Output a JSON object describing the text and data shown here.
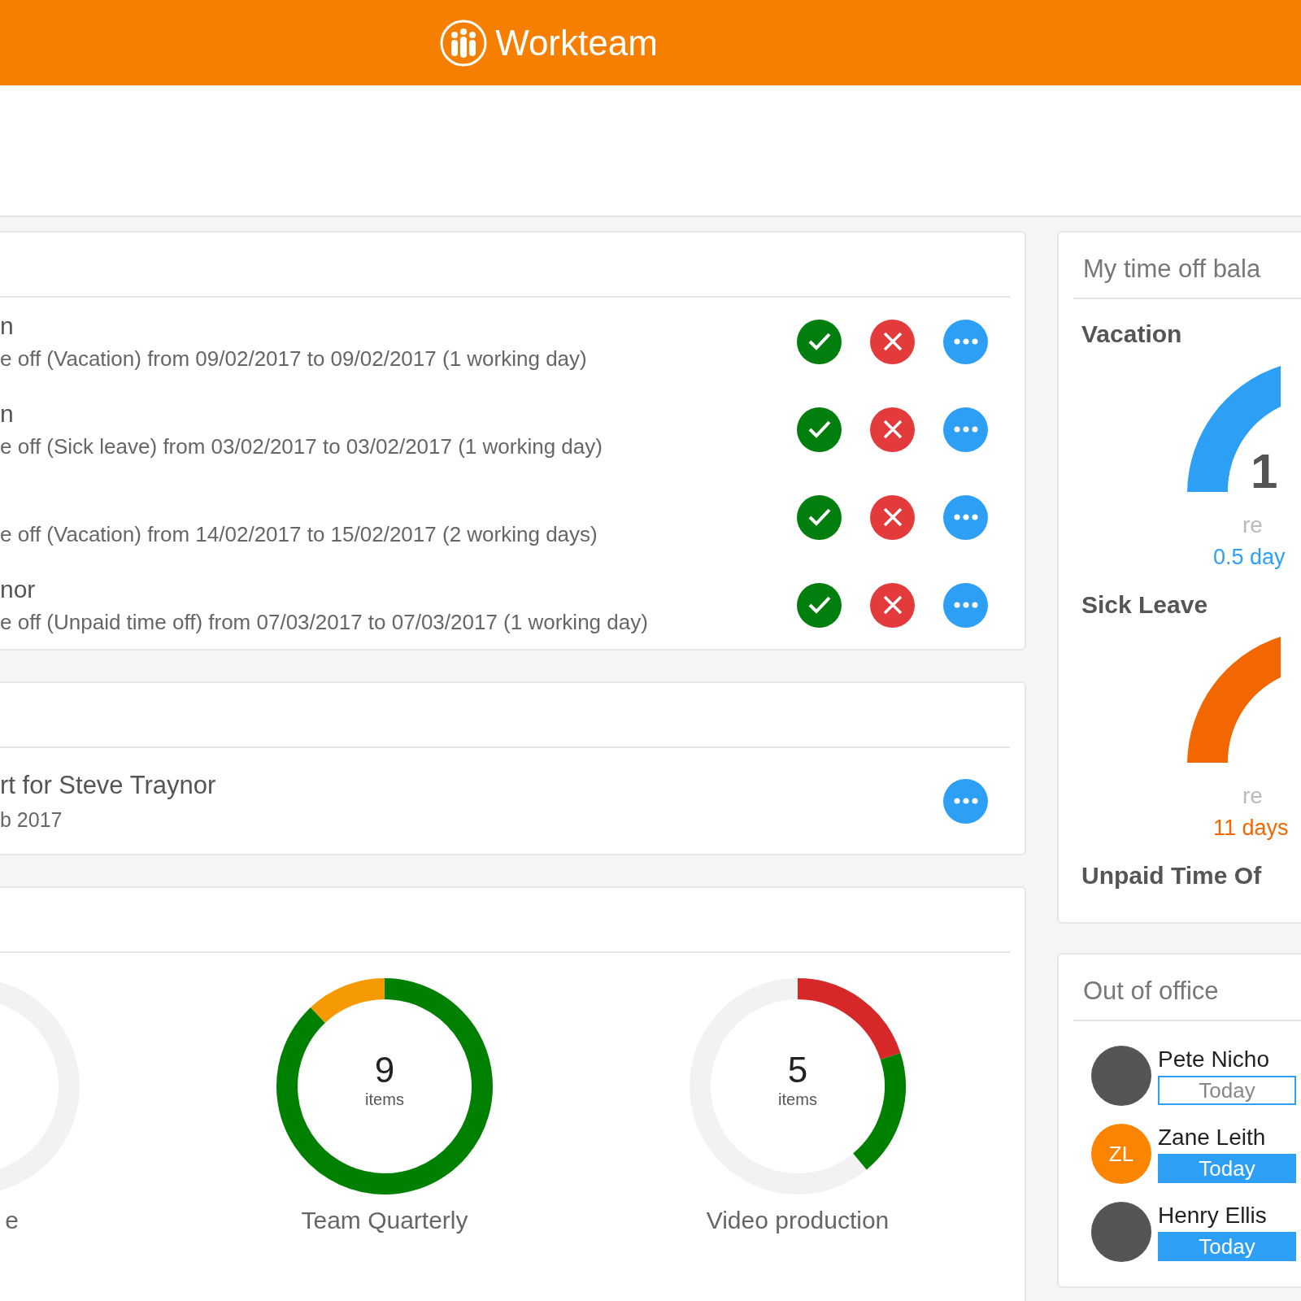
{
  "header": {
    "title": "Workteam"
  },
  "requests": {
    "rows": [
      {
        "title": "n",
        "detail": "e off (Vacation) from 09/02/2017 to 09/02/2017 (1 working day)",
        "actions": [
          {
            "kind": "approve"
          },
          {
            "kind": "reject"
          },
          {
            "kind": "more"
          }
        ]
      },
      {
        "title": "n",
        "detail": "e off (Sick leave) from 03/02/2017 to 03/02/2017 (1 working day)",
        "actions": [
          {
            "kind": "approve"
          },
          {
            "kind": "reject"
          },
          {
            "kind": "more"
          }
        ]
      },
      {
        "detail": "e off (Vacation) from 14/02/2017 to 15/02/2017 (2 working days)",
        "actions": [
          {
            "kind": "approve"
          },
          {
            "kind": "reject"
          },
          {
            "kind": "more"
          }
        ]
      },
      {
        "title": "nor",
        "detail": "e off (Unpaid time off) from 07/03/2017 to 07/03/2017 (1 working day)",
        "actions": [
          {
            "kind": "approve"
          },
          {
            "kind": "reject"
          },
          {
            "kind": "more"
          }
        ]
      }
    ]
  },
  "reports": {
    "rows": [
      {
        "title": "rt for Steve Traynor",
        "detail": "b 2017",
        "actions": [
          {
            "kind": "more"
          }
        ]
      }
    ]
  },
  "projects": [
    {
      "label": "e"
    },
    {
      "count": "9",
      "unit": "items",
      "label": "Team Quarterly"
    },
    {
      "count": "5",
      "unit": "items",
      "label": "Video production"
    }
  ],
  "balance": {
    "title": "My time off bala",
    "types": [
      {
        "name": "Vacation",
        "color": "#2d9ff5",
        "value": "1",
        "caption": "re",
        "note": "0.5 day"
      },
      {
        "name": "Sick Leave",
        "color": "#f26700",
        "caption": "re",
        "note": "11 days"
      },
      {
        "name": "Unpaid Time Of"
      }
    ]
  },
  "out_of_office": {
    "title": "Out of office",
    "people": [
      {
        "name": "Pete Nicho",
        "kind": "photo",
        "when": "Today",
        "filled": false
      },
      {
        "name": "Zane Leith",
        "kind": "initials",
        "initials": "ZL",
        "when": "Today",
        "filled": true
      },
      {
        "name": "Henry Ellis",
        "kind": "photo",
        "when": "Today",
        "filled": true
      }
    ]
  }
}
